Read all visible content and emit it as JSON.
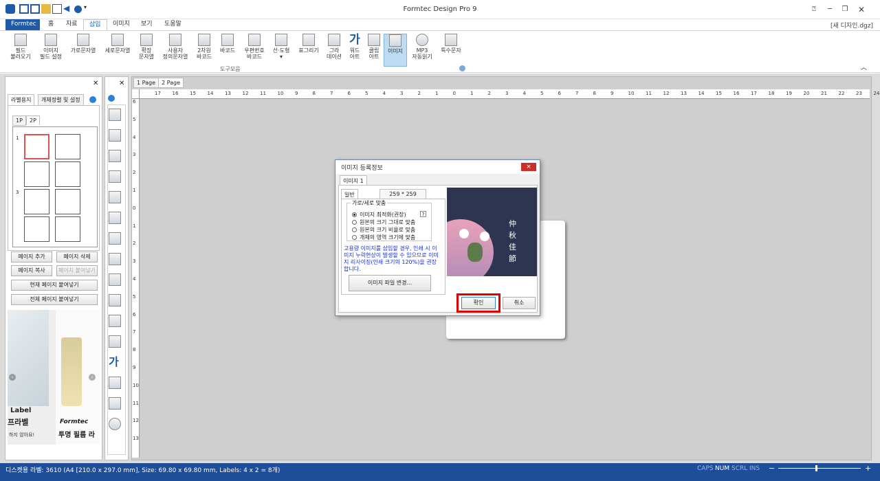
{
  "app": {
    "title": "Formtec Design Pro 9",
    "filename": "[새 디자인.dgz]"
  },
  "menu": {
    "tabs": [
      "Formtec",
      "홈",
      "자료",
      "삽입",
      "이미지",
      "보기",
      "도움말"
    ],
    "active": "삽입"
  },
  "ribbon": {
    "buttons": [
      {
        "l1": "필드",
        "l2": "불러오기"
      },
      {
        "l1": "이미지",
        "l2": "필드 설정"
      },
      {
        "l1": "가로문자열",
        "l2": ""
      },
      {
        "l1": "세로문자열",
        "l2": ""
      },
      {
        "l1": "확장",
        "l2": "문자열"
      },
      {
        "l1": "사용자",
        "l2": "정의문자열"
      },
      {
        "l1": "2차원",
        "l2": "바코드"
      },
      {
        "l1": "바코드",
        "l2": ""
      },
      {
        "l1": "우편번호",
        "l2": "바코드"
      },
      {
        "l1": "선·도형",
        "l2": "▾"
      },
      {
        "l1": "표그리기",
        "l2": ""
      },
      {
        "l1": "그라",
        "l2": "데이션"
      },
      {
        "l1": "워드",
        "l2": "아트"
      },
      {
        "l1": "클립",
        "l2": "아트"
      },
      {
        "l1": "이미지",
        "l2": ""
      },
      {
        "l1": "MP3",
        "l2": "자동읽기"
      },
      {
        "l1": "특수문자",
        "l2": ""
      }
    ],
    "group_label": "도구모음",
    "selected": "이미지"
  },
  "left_panel": {
    "tabs": [
      "라벨용지",
      "개체정렬 및 설정"
    ],
    "page_tabs": [
      "1P",
      "2P"
    ],
    "row_labels": [
      "1",
      "3"
    ],
    "buttons": {
      "add_page": "페이지 추가",
      "delete_page": "페이지 삭제",
      "copy_page": "페이지 복사",
      "paste_page": "페이지 붙여넣기",
      "paste_current": "현재 페이지 붙여넣기",
      "paste_all": "전체 페이지 붙여넣기"
    },
    "ad": {
      "line1": "Label",
      "line2": "프라벨",
      "line3": "하지 않아요!",
      "brand": "Formtec",
      "line4": "투명 필름 라"
    }
  },
  "document": {
    "tabs": [
      "1 Page",
      "2 Page"
    ],
    "active_tab": "2 Page"
  },
  "ruler": {
    "top": [
      "17",
      "16",
      "15",
      "14",
      "13",
      "12",
      "11",
      "10",
      "9",
      "8",
      "7",
      "6",
      "5",
      "4",
      "3",
      "2",
      "1",
      "0",
      "1",
      "2",
      "3",
      "4",
      "5",
      "6",
      "7",
      "8",
      "9",
      "10",
      "11",
      "12",
      "13",
      "14",
      "15",
      "16",
      "17",
      "18",
      "19",
      "20",
      "21",
      "22",
      "23",
      "24"
    ],
    "left": [
      "6",
      "5",
      "4",
      "3",
      "2",
      "1",
      "0",
      "1",
      "2",
      "3",
      "4",
      "5",
      "6",
      "7",
      "8",
      "9",
      "10",
      "11",
      "12",
      "13"
    ]
  },
  "dialog": {
    "title": "이미지 등록정보",
    "close": "×",
    "tab": "이미지 1",
    "subtab": "일반",
    "dimensions": "259 * 259",
    "fit_group_label": "가로/세로 맞춤",
    "options": [
      "이미지 최적화(권장)",
      "원본의 크기 그대로 맞춤",
      "원본의 크기 비율로 맞춤",
      "개체의 영역 크기에 맞춤"
    ],
    "help": "?",
    "notice": "고용량 이미지를 삽입할 경우, 인쇄 시 이미지 누락현상이 발생할 수 있으므로 이미지 리사이징(인쇄 크기의 120%)을 권장합니다.",
    "change_file": "이미지 파일 변경...",
    "ok": "확인",
    "cancel": "취소",
    "preview_text": "仲秋佳節"
  },
  "status": {
    "text": "디스켓용 라벨: 3610 (A4 [210.0 x 297.0 mm], Size: 69.80 x 69.80 mm,  Labels: 4 x 2 = 8개)",
    "caps": "CAPS",
    "num": "NUM",
    "scrl": "SCRL",
    "ins": "INS"
  },
  "colors": {
    "brand": "#1f5aa8",
    "highlight": "#e00000",
    "status_bg": "#1f4e99"
  }
}
